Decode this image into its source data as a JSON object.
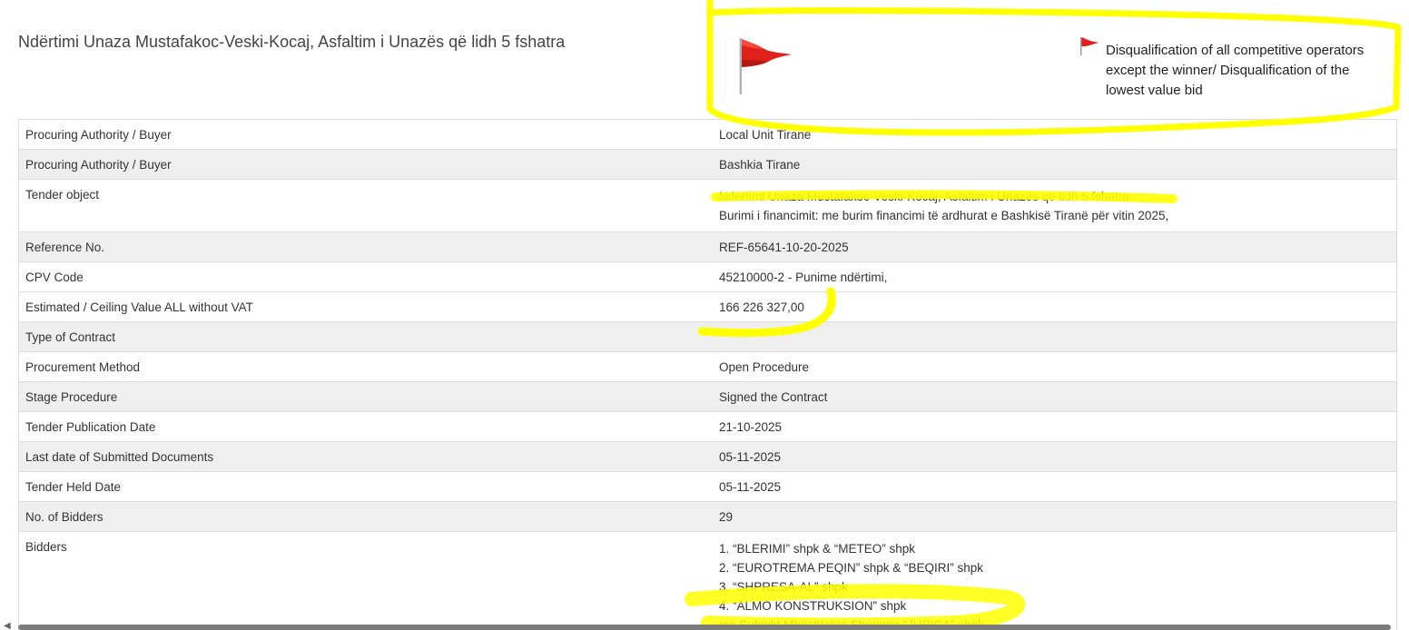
{
  "header": {
    "title": "Ndërtimi Unaza Mustafakoc-Veski-Kocaj, Asfaltim i Unazës që lidh 5 fshatra",
    "flag_icon": "red-flag-icon",
    "red_flag_text": "Disqualification of all competitive operators except the winner/ Disqualification of the lowest value bid"
  },
  "rows": [
    {
      "label": "Procuring Authority / Buyer",
      "value": "Local Unit Tiranë"
    },
    {
      "label": "Procuring Authority / Buyer",
      "value": "Bashkia Tirane"
    },
    {
      "label": "Tender object",
      "value": "Ndërtimi Unaza Mustafakoc-Veski-Kocaj, Asfaltim i Unazës që lidh 5 fshatra",
      "value2": "Burimi i financimit: me burim financimi të ardhurat e Bashkisë Tiranë për vitin 2025,"
    },
    {
      "label": "Reference No.",
      "value": "REF-65641-10-20-2025"
    },
    {
      "label": "CPV Code",
      "value": "45210000-2 - Punime ndërtimi,"
    },
    {
      "label": "Estimated / Ceiling Value ALL without VAT",
      "value": "166 226 327,00"
    },
    {
      "label": "Type of Contract",
      "value": ""
    },
    {
      "label": "Procurement Method",
      "value": "Open Procedure"
    },
    {
      "label": "Stage Procedure",
      "value": "Signed the Contract"
    },
    {
      "label": "Tender Publication Date",
      "value": "21-10-2025"
    },
    {
      "label": "Last date of Submitted Documents",
      "value": "05-11-2025"
    },
    {
      "label": "Tender Held Date",
      "value": "05-11-2025"
    },
    {
      "label": "No. of Bidders",
      "value": "29"
    }
  ],
  "bidders": {
    "label": "Bidders",
    "items": [
      "1. “BLERIMI” shpk & “METEO” shpk",
      "2. “EUROTREMA PEQIN” shpk & “BEQIRI” shpk",
      "3. “SHPRESA-AL” shpk",
      "4. “ALMO KONSTRUKSION” shpk",
      "me Subjekt Mbështetës Shoqeria “JUBICA” shpk"
    ]
  },
  "colors": {
    "highlight": "#ffff00",
    "flag_red": "#e0201a",
    "row_alt": "#efefef",
    "border": "#dddddd"
  }
}
